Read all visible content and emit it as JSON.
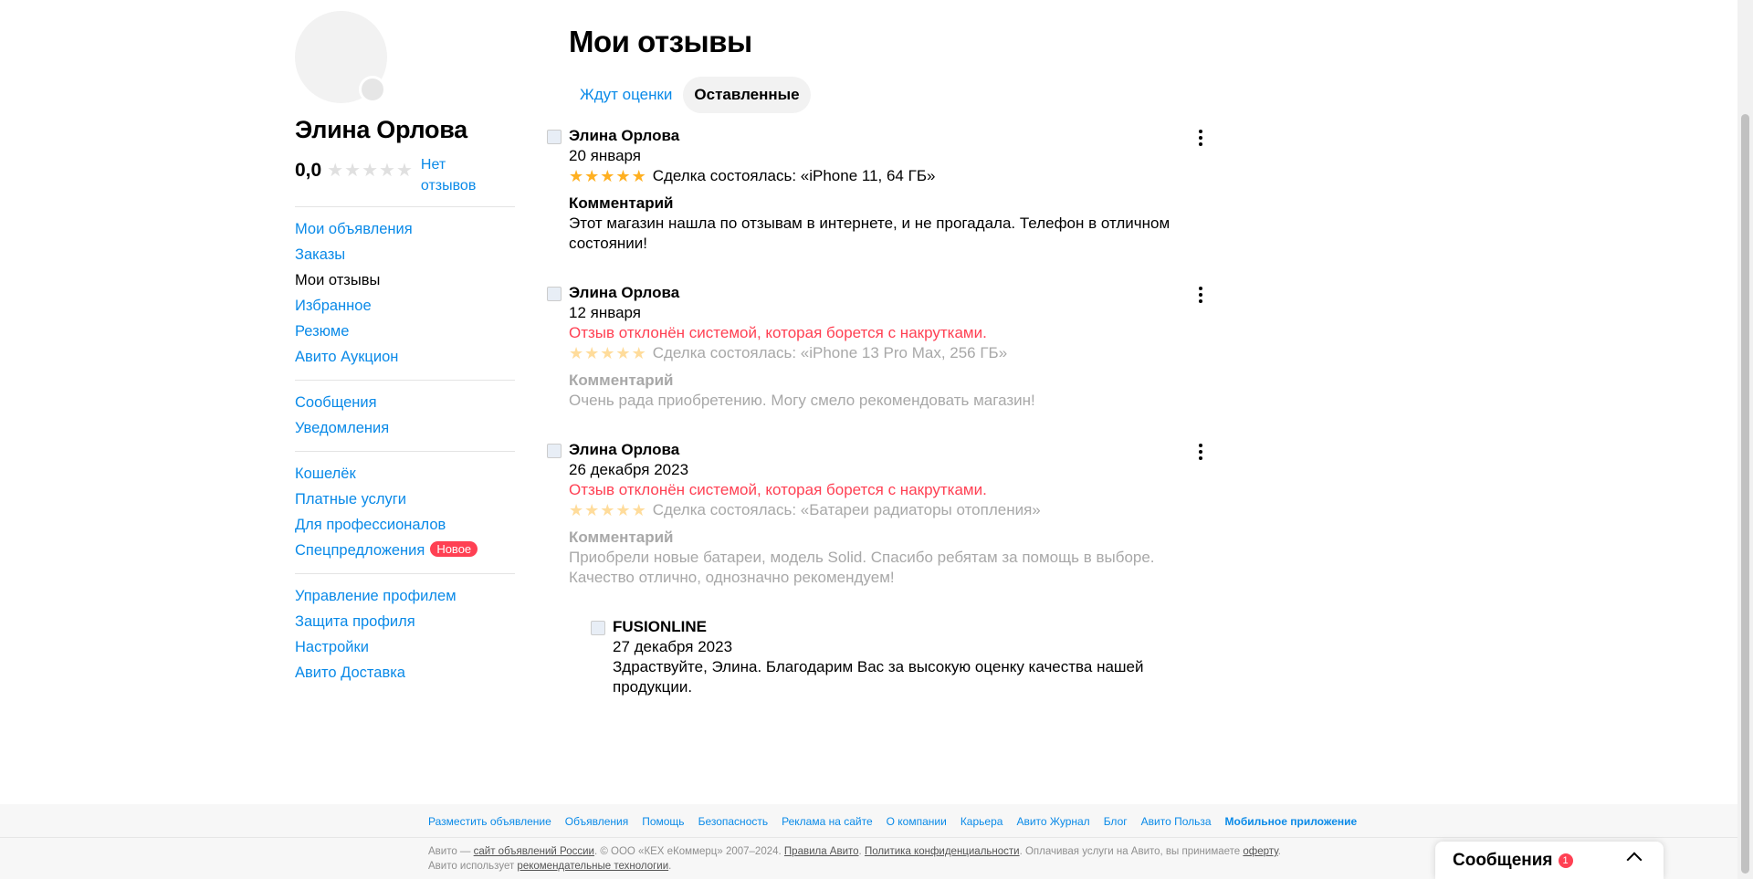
{
  "profile": {
    "name": "Элина Орлова",
    "rating_value": "0,0",
    "rating_stars": 0,
    "no_reviews_label": "Нет отзывов"
  },
  "sidebar": {
    "groups": [
      [
        {
          "label": "Мои объявления",
          "active": false
        },
        {
          "label": "Заказы",
          "active": false
        },
        {
          "label": "Мои отзывы",
          "active": true
        },
        {
          "label": "Избранное",
          "active": false
        },
        {
          "label": "Резюме",
          "active": false
        },
        {
          "label": "Авито Аукцион",
          "active": false
        }
      ],
      [
        {
          "label": "Сообщения",
          "active": false
        },
        {
          "label": "Уведомления",
          "active": false
        }
      ],
      [
        {
          "label": "Кошелёк",
          "active": false
        },
        {
          "label": "Платные услуги",
          "active": false
        },
        {
          "label": "Для профессионалов",
          "active": false
        },
        {
          "label": "Спецпредложения",
          "active": false,
          "badge": "Новое"
        }
      ],
      [
        {
          "label": "Управление профилем",
          "active": false
        },
        {
          "label": "Защита профиля",
          "active": false
        },
        {
          "label": "Настройки",
          "active": false
        },
        {
          "label": "Авито Доставка",
          "active": false
        }
      ]
    ]
  },
  "main": {
    "title": "Мои отзывы",
    "tabs": [
      {
        "label": "Ждут оценки",
        "active": false
      },
      {
        "label": "Оставленные",
        "active": true
      }
    ],
    "comment_title": "Комментарий",
    "reviews": [
      {
        "author": "Элина Орлова",
        "date": "20 января",
        "rejected": "",
        "stars": 5,
        "deal": "Сделка состоялась: «iPhone 11, 64 ГБ»",
        "comment": "Этот магазин нашла по отзывам в интернете, и не прогадала. Телефон в отличном состоянии!"
      },
      {
        "author": "Элина Орлова",
        "date": "12 января",
        "rejected": "Отзыв отклонён системой, которая борется с накрутками.",
        "stars": 5,
        "deal": "Сделка состоялась: «iPhone 13 Pro Max, 256 ГБ»",
        "comment": "Очень рада приобретению. Могу смело рекомендовать магазин!"
      },
      {
        "author": "Элина Орлова",
        "date": "26 декабря 2023",
        "rejected": "Отзыв отклонён системой, которая борется с накрутками.",
        "stars": 5,
        "deal": "Сделка состоялась: «Батареи радиаторы отопления»",
        "comment": "Приобрели новые батареи, модель Solid. Спасибо ребятам за помощь в выборе. Качество отлично, однозначно рекомендуем!"
      }
    ],
    "reply": {
      "author": "FUSIONLINE",
      "date": "27 декабря 2023",
      "text": "Здраствуйте, Элина. Благодарим Вас за высокую оценку качества нашей продукции."
    }
  },
  "footer": {
    "links": [
      "Разместить объявление",
      "Объявления",
      "Помощь",
      "Безопасность",
      "Реклама на сайте",
      "О компании",
      "Карьера",
      "Авито Журнал",
      "Блог",
      "Авито Польза",
      "Мобильное приложение"
    ],
    "legal_1": "Авито — ",
    "legal_link_1": "сайт объявлений России",
    "legal_2": ". © ООО «КЕХ еКоммерц» 2007–2024. ",
    "legal_link_2": "Правила Авито",
    "legal_3": ". ",
    "legal_link_3": "Политика конфиденциальности",
    "legal_4": ". Оплачивая услуги на Авито, вы принимаете ",
    "legal_link_4": "оферту",
    "legal_5": ". Авито использует ",
    "legal_link_5": "рекомендательные технологии",
    "legal_6": "."
  },
  "messenger": {
    "title": "Сообщения",
    "count": "1"
  },
  "colors": {
    "link": "#0a8ae8",
    "star_active": "#ffb021",
    "star_faded": "#ffdc9b",
    "rejected": "#ff4053",
    "badge": "#ff4053"
  }
}
